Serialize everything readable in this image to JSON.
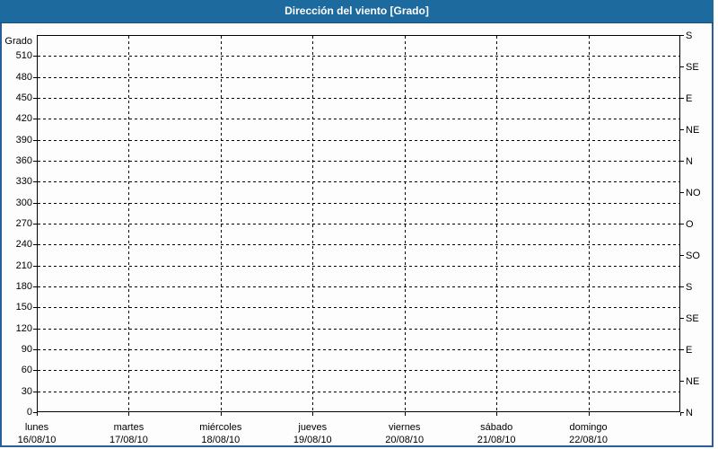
{
  "window": {
    "title": "Dirección del viento [Grado]"
  },
  "colors": {
    "titlebar_bg": "#1d6a9e",
    "titlebar_text": "#ffffff",
    "page_border": "#2a5d9e",
    "grid": "#000000",
    "text": "#000000",
    "background": "#ffffff"
  },
  "chart_data": {
    "type": "line",
    "title": "Dirección del viento [Grado]",
    "ylabel": "Grado",
    "ylim": [
      0,
      540
    ],
    "y_tick_step": 30,
    "y_tick_labels": [
      "0",
      "30",
      "60",
      "90",
      "120",
      "150",
      "180",
      "210",
      "240",
      "270",
      "300",
      "330",
      "360",
      "390",
      "420",
      "450",
      "480",
      "510"
    ],
    "right_axis": {
      "values": [
        0,
        45,
        90,
        135,
        180,
        225,
        270,
        315,
        360,
        405,
        450,
        495,
        540
      ],
      "labels": [
        "N",
        "NE",
        "E",
        "SE",
        "S",
        "SO",
        "O",
        "NO",
        "N",
        "NE",
        "E",
        "SE",
        "S"
      ]
    },
    "x_axis": {
      "days": [
        {
          "name": "lunes",
          "date": "16/08/10"
        },
        {
          "name": "martes",
          "date": "17/08/10"
        },
        {
          "name": "miércoles",
          "date": "18/08/10"
        },
        {
          "name": "jueves",
          "date": "19/08/10"
        },
        {
          "name": "viernes",
          "date": "20/08/10"
        },
        {
          "name": "sábado",
          "date": "21/08/10"
        },
        {
          "name": "domingo",
          "date": "22/08/10"
        }
      ]
    },
    "grid": true,
    "legend": "none",
    "series": []
  }
}
